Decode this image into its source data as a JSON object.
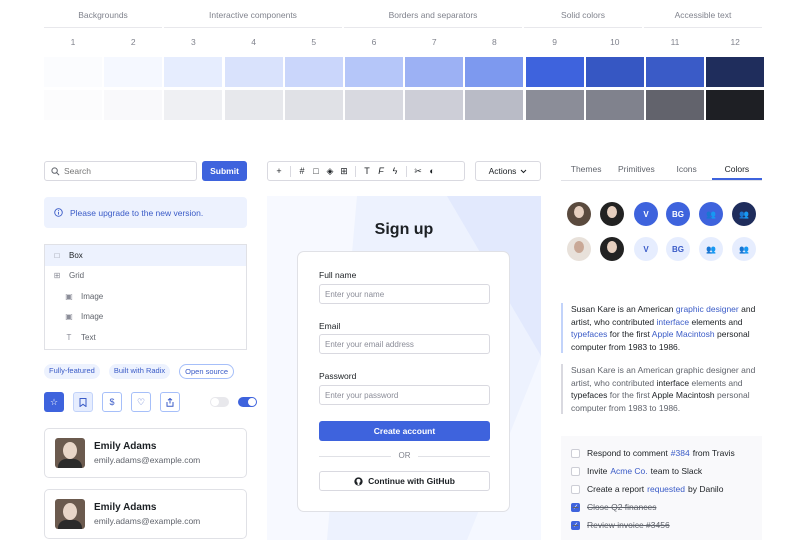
{
  "scale": {
    "headings": [
      "Backgrounds",
      "Interactive components",
      "Borders and separators",
      "Solid colors",
      "Accessible text"
    ],
    "steps": [
      "1",
      "2",
      "3",
      "4",
      "5",
      "6",
      "7",
      "8",
      "9",
      "10",
      "11",
      "12"
    ],
    "blue": [
      "#fbfcfe",
      "#f5f8ff",
      "#e6edfe",
      "#d9e2fc",
      "#cad6fb",
      "#b5c6f9",
      "#9cb1f4",
      "#7d99ef",
      "#3e63dd",
      "#3657c3",
      "#3a5bc7",
      "#1f2d5c"
    ],
    "gray": [
      "#fcfcfd",
      "#f9f9fb",
      "#eff0f3",
      "#e7e8ec",
      "#e0e1e6",
      "#d8d9e0",
      "#cdced7",
      "#b9bbc6",
      "#8b8d98",
      "#80828d",
      "#62636c",
      "#1e1f24"
    ]
  },
  "search": {
    "placeholder": "Search",
    "submit_label": "Submit"
  },
  "callout": {
    "text": "Please upgrade to the new version.",
    "icon": "info-icon"
  },
  "tree": {
    "items": [
      {
        "label": "Box",
        "icon": "square-icon"
      },
      {
        "label": "Grid",
        "icon": "grid-icon"
      },
      {
        "label": "Image",
        "icon": "image-icon"
      },
      {
        "label": "Image",
        "icon": "image-icon"
      },
      {
        "label": "Text",
        "icon": "text-icon"
      }
    ]
  },
  "badges": [
    "Fully-featured",
    "Built with Radix",
    "Open source"
  ],
  "users": [
    {
      "name": "Emily Adams",
      "email": "emily.adams@example.com"
    },
    {
      "name": "Emily Adams",
      "email": "emily.adams@example.com"
    }
  ],
  "toolbar": {
    "actions_label": "Actions"
  },
  "signup": {
    "title": "Sign up",
    "fullname_label": "Full name",
    "fullname_placeholder": "Enter your name",
    "email_label": "Email",
    "email_placeholder": "Enter your email address",
    "password_label": "Password",
    "password_placeholder": "Enter your password",
    "create_label": "Create account",
    "or_label": "OR",
    "github_label": "Continue with GitHub"
  },
  "tabs": [
    "Themes",
    "Primitives",
    "Icons",
    "Colors"
  ],
  "avatars": {
    "v": "V",
    "bg": "BG"
  },
  "quote": {
    "t1": "Susan Kare is an American ",
    "l1": "graphic designer",
    "t2": " and artist, who contributed ",
    "l2": "interface",
    "t3": " elements and ",
    "l3": "typefaces",
    "t4": " for the first ",
    "l4": "Apple Macintosh",
    "t5": " personal computer from 1983 to 1986."
  },
  "todos": [
    {
      "pre": "Respond to comment",
      "link": "#384",
      "post": "from Travis",
      "checked": false
    },
    {
      "pre": "Invite",
      "link": "Acme Co.",
      "post": "team to Slack",
      "checked": false
    },
    {
      "pre": "Create a report",
      "link": "requested",
      "post": "by Danilo",
      "checked": false
    },
    {
      "pre": "Close Q2 finances",
      "link": "",
      "post": "",
      "checked": true
    },
    {
      "pre": "Review invoice #3456",
      "link": "",
      "post": "",
      "checked": true
    }
  ]
}
